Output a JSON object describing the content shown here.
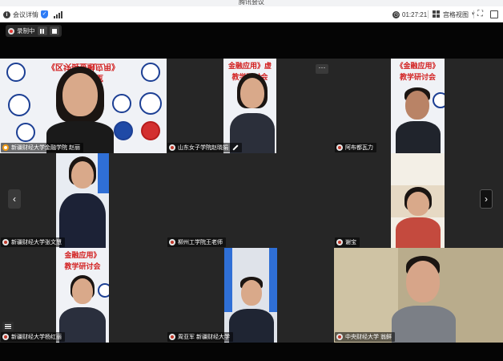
{
  "window": {
    "title": "腾讯会议"
  },
  "toolbar": {
    "meeting_info_label": "会议详情",
    "meeting_info_icon": "info-icon",
    "security_icon": "shield-icon",
    "signal_icon": "signal-icon",
    "timer": "01:27:21",
    "view_label": "宫格视图",
    "view_icon": "grid-view-icon",
    "fullscreen_icon": "fullscreen-icon",
    "window_icon": "window-icon",
    "exit_icon": "exit-fullscreen-icon"
  },
  "recording": {
    "label": "录制中",
    "pause_icon": "pause-icon",
    "stop_icon": "stop-icon"
  },
  "banner_texts": {
    "t1_line1": "《区块链金融应用》",
    "t1_line2": "虚拟教研室",
    "t2_line1": "金融应用》虚",
    "t2_line2": "教学研讨会",
    "t3_line1": "《金融应用》",
    "t3_line2": "教学研讨会",
    "t4_line1": "金融应用》",
    "t4_line2": "教学研讨会"
  },
  "participants": [
    {
      "name": "新疆财经大学金融学院 赵丽",
      "active": true
    },
    {
      "name": "山东女子学院赵晓娟",
      "editing": true
    },
    {
      "name": "阿布都瓦力"
    },
    {
      "name": "新疆财经大学张文慧"
    },
    {
      "name": "柳州工学院王老师"
    },
    {
      "name": "谢宝"
    },
    {
      "name": "新疆财经大学杨红丽"
    },
    {
      "name": "周亚军 新疆财经大学"
    },
    {
      "name": "中央财经大学 翁鲜"
    }
  ],
  "nav": {
    "prev": "‹",
    "next": "›",
    "more": "···"
  },
  "colors": {
    "active_border": "#2ec26a",
    "banner_red": "#d21f1f",
    "stage_bg": "#050505"
  }
}
